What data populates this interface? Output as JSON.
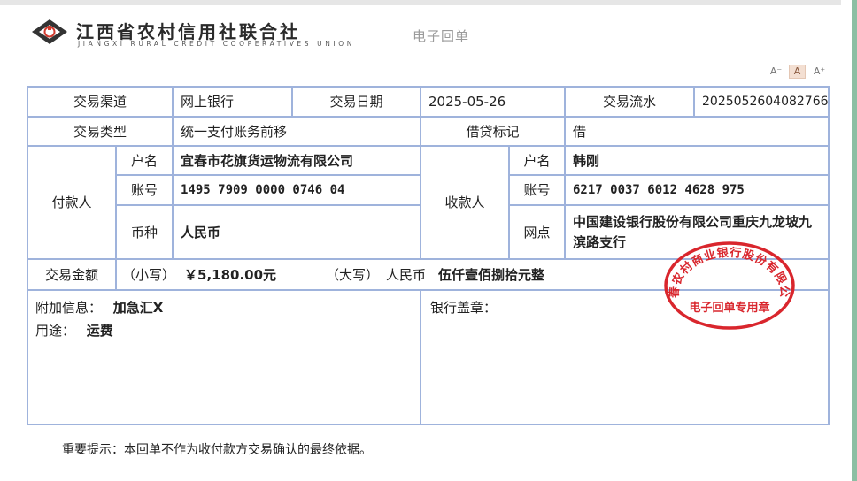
{
  "header": {
    "org_name": "江西省农村信用社联合社",
    "org_name_en": "JIANGXI RURAL CREDIT COOPERATIVES UNION",
    "doc_title": "电子回单"
  },
  "font_controls": {
    "decrease": "A⁻",
    "normal": "A",
    "increase": "A⁺"
  },
  "receipt": {
    "channel_label": "交易渠道",
    "channel": "网上银行",
    "date_label": "交易日期",
    "date": "2025-05-26",
    "serial_label": "交易流水",
    "serial": "2025052604082766",
    "type_label": "交易类型",
    "type": "统一支付账务前移",
    "dc_label": "借贷标记",
    "dc": "借",
    "payer": {
      "label": "付款人",
      "name_label": "户名",
      "name": "宜春市花旗货运物流有限公司",
      "account_label": "账号",
      "account": "1495 7909 0000 0746 04",
      "currency_label": "币种",
      "currency": "人民币"
    },
    "payee": {
      "label": "收款人",
      "name_label": "户名",
      "name": "韩刚",
      "account_label": "账号",
      "account": "6217 0037 6012 4628 975",
      "branch_label": "网点",
      "branch": "中国建设银行股份有限公司重庆九龙坡九滨路支行"
    },
    "amount": {
      "label": "交易金额",
      "small_label": "（小写）",
      "small": "￥5,180.00元",
      "big_label": "（大写）",
      "big_currency": "人民币",
      "big": "伍仟壹佰捌拾元整"
    },
    "extra_label": "附加信息：",
    "extra": "加急汇X",
    "usage_label": "用途：",
    "usage": "运费",
    "stamp_label": "银行盖章："
  },
  "seal": {
    "org_text": "宜春农村商业银行股份有限公司",
    "purpose_text": "电子回单专用章",
    "color": "#d9262d"
  },
  "footnote": "重要提示：本回单不作为收付款方交易确认的最终依据。",
  "colors": {
    "table_border": "#9fb3dc",
    "seal": "#d9262d"
  }
}
